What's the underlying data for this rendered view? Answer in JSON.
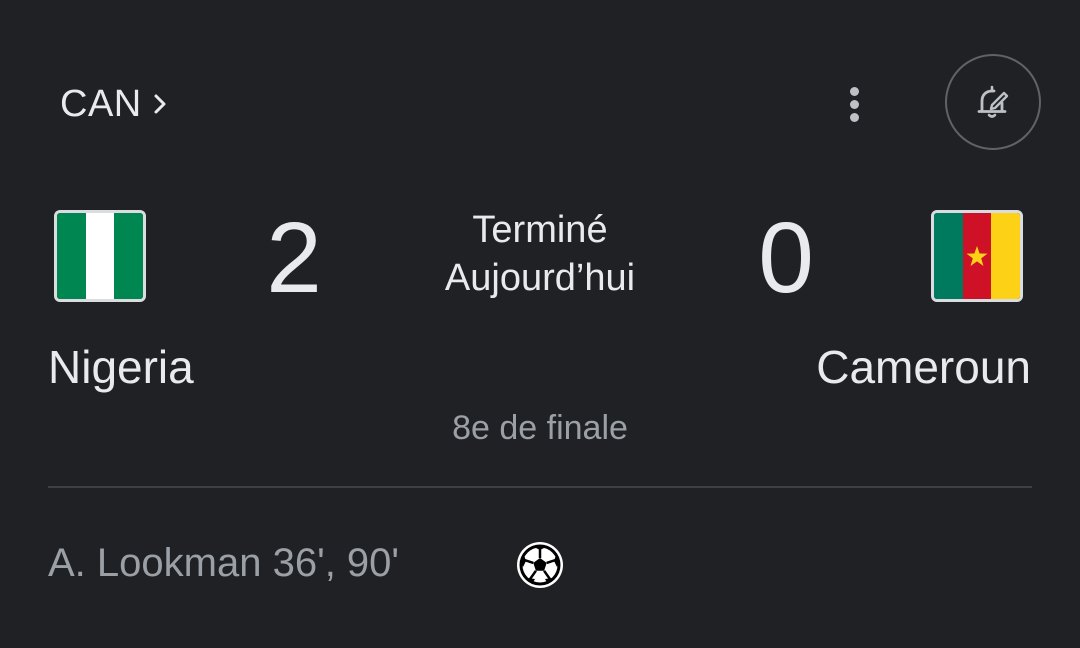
{
  "header": {
    "league_label": "CAN",
    "icons": {
      "chevron": "chevron-right-icon",
      "more": "more-vert-icon",
      "bell": "notification-bell-edit-icon"
    }
  },
  "match": {
    "status": "Terminé",
    "date": "Aujourd’hui",
    "stage": "8e de finale",
    "home": {
      "name": "Nigeria",
      "score": "2",
      "flag_icon": "nigeria-flag-icon",
      "flag_colors": [
        "#008751",
        "#ffffff",
        "#008751"
      ]
    },
    "away": {
      "name": "Cameroun",
      "score": "0",
      "flag_icon": "cameroon-flag-icon",
      "flag_colors": [
        "#007a5e",
        "#ce1126",
        "#fcd116"
      ]
    }
  },
  "events": [
    {
      "scorer": "A. Lookman 36', 90'",
      "icon": "soccer-ball-icon"
    }
  ],
  "colors": {
    "background": "#202124",
    "text_primary": "#e8eaed",
    "text_secondary": "#9aa0a6",
    "divider": "#3c4043"
  }
}
